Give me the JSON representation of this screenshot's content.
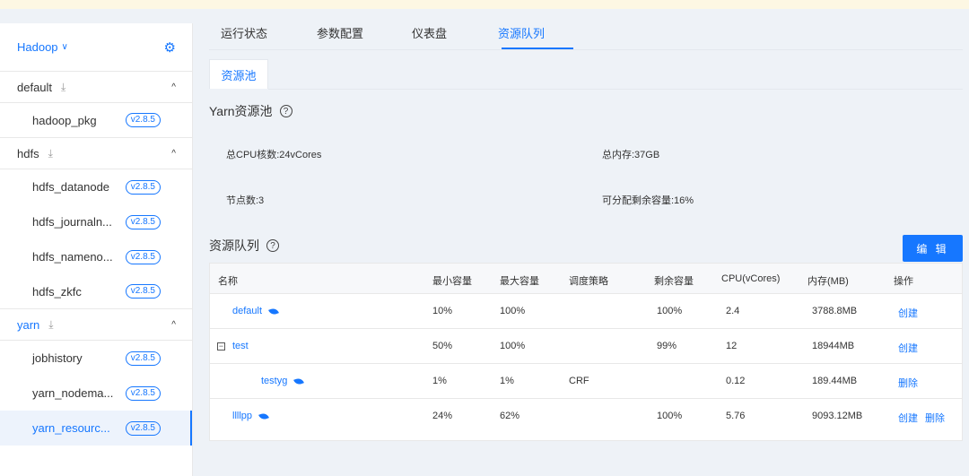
{
  "sidebar": {
    "cluster": "Hadoop",
    "groups": [
      {
        "name": "default",
        "services": [
          {
            "name": "hadoop_pkg",
            "version": "v2.8.5"
          }
        ]
      },
      {
        "name": "hdfs",
        "services": [
          {
            "name": "hdfs_datanode",
            "version": "v2.8.5"
          },
          {
            "name": "hdfs_journaln...",
            "version": "v2.8.5"
          },
          {
            "name": "hdfs_nameno...",
            "version": "v2.8.5"
          },
          {
            "name": "hdfs_zkfc",
            "version": "v2.8.5"
          }
        ]
      },
      {
        "name": "yarn",
        "services": [
          {
            "name": "jobhistory",
            "version": "v2.8.5"
          },
          {
            "name": "yarn_nodema...",
            "version": "v2.8.5"
          },
          {
            "name": "yarn_resourc...",
            "version": "v2.8.5"
          }
        ]
      }
    ]
  },
  "tabs": [
    "运行状态",
    "参数配置",
    "仪表盘",
    "资源队列"
  ],
  "subtab": "资源池",
  "pool": {
    "title": "Yarn资源池",
    "cpu": "总CPU核数:24vCores",
    "memory": "总内存:37GB",
    "nodes": "节点数:3",
    "remaining": "可分配剩余容量:16%"
  },
  "queue": {
    "title": "资源队列",
    "edit_label": "编 辑",
    "headers": [
      "名称",
      "最小容量",
      "最大容量",
      "调度策略",
      "剩余容量",
      "CPU(vCores)",
      "内存(MB)",
      "操作"
    ],
    "rows": [
      {
        "name": "default",
        "min": "10%",
        "max": "100%",
        "policy": "",
        "remain": "100%",
        "cpu": "2.4",
        "mem": "3788.8MB",
        "op1": "创建",
        "op2": ""
      },
      {
        "name": "test",
        "min": "50%",
        "max": "100%",
        "policy": "",
        "remain": "99%",
        "cpu": "12",
        "mem": "18944MB",
        "op1": "创建",
        "op2": ""
      },
      {
        "name": "testyg",
        "min": "1%",
        "max": "1%",
        "policy": "CRF",
        "remain": "",
        "cpu": "0.12",
        "mem": "189.44MB",
        "op1": "删除",
        "op2": ""
      },
      {
        "name": "llllpp",
        "min": "24%",
        "max": "62%",
        "policy": "",
        "remain": "100%",
        "cpu": "5.76",
        "mem": "9093.12MB",
        "op1": "创建",
        "op2": "删除"
      }
    ]
  }
}
